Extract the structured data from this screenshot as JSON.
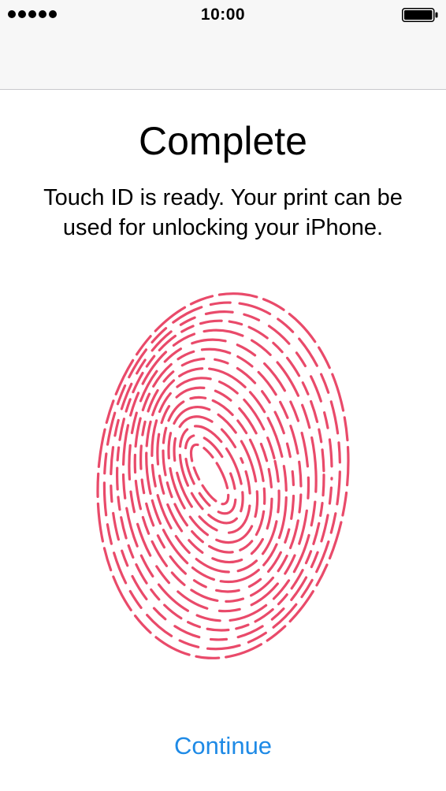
{
  "status_bar": {
    "time": "10:00",
    "signal_icon": "signal-dots-icon",
    "battery_icon": "battery-full-icon"
  },
  "main": {
    "title": "Complete",
    "subtitle": "Touch ID is ready. Your print can be used for unlocking your iPhone.",
    "fingerprint_icon": "fingerprint-icon",
    "fingerprint_color": "#e94a6a",
    "continue_label": "Continue",
    "accent_color": "#1e8ae6"
  }
}
